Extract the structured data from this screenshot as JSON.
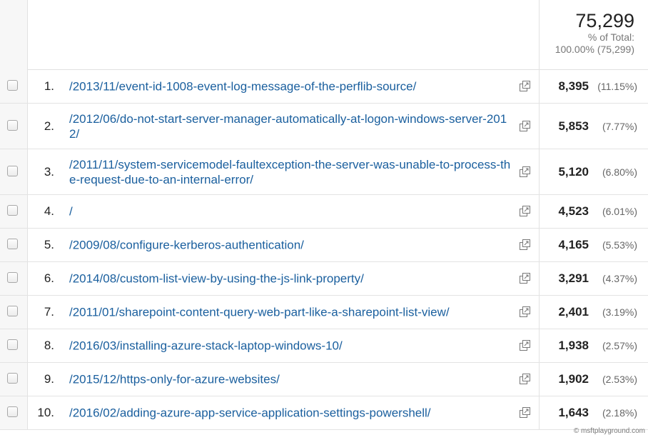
{
  "summary": {
    "total_value": "75,299",
    "pct_label": "% of Total:",
    "pct_detail": "100.00% (75,299)"
  },
  "rows": [
    {
      "num": "1.",
      "url": "/2013/11/event-id-1008-event-log-message-of-the-perflib-source/",
      "value": "8,395",
      "pct": "(11.15%)"
    },
    {
      "num": "2.",
      "url": "/2012/06/do-not-start-server-manager-automatically-at-logon-windows-server-2012/",
      "value": "5,853",
      "pct": "(7.77%)"
    },
    {
      "num": "3.",
      "url": "/2011/11/system-servicemodel-faultexception-the-server-was-unable-to-process-the-request-due-to-an-internal-error/",
      "value": "5,120",
      "pct": "(6.80%)"
    },
    {
      "num": "4.",
      "url": "/",
      "value": "4,523",
      "pct": "(6.01%)"
    },
    {
      "num": "5.",
      "url": "/2009/08/configure-kerberos-authentication/",
      "value": "4,165",
      "pct": "(5.53%)"
    },
    {
      "num": "6.",
      "url": "/2014/08/custom-list-view-by-using-the-js-link-property/",
      "value": "3,291",
      "pct": "(4.37%)"
    },
    {
      "num": "7.",
      "url": "/2011/01/sharepoint-content-query-web-part-like-a-sharepoint-list-view/",
      "value": "2,401",
      "pct": "(3.19%)"
    },
    {
      "num": "8.",
      "url": "/2016/03/installing-azure-stack-laptop-windows-10/",
      "value": "1,938",
      "pct": "(2.57%)"
    },
    {
      "num": "9.",
      "url": "/2015/12/https-only-for-azure-websites/",
      "value": "1,902",
      "pct": "(2.53%)"
    },
    {
      "num": "10.",
      "url": "/2016/02/adding-azure-app-service-application-settings-powershell/",
      "value": "1,643",
      "pct": "(2.18%)"
    }
  ],
  "icons": {
    "row_action": "open-in-new-window-icon"
  },
  "watermark": "© msftplayground.com",
  "colors": {
    "link": "#1a5f9e",
    "text": "#222222",
    "muted": "#777777"
  }
}
